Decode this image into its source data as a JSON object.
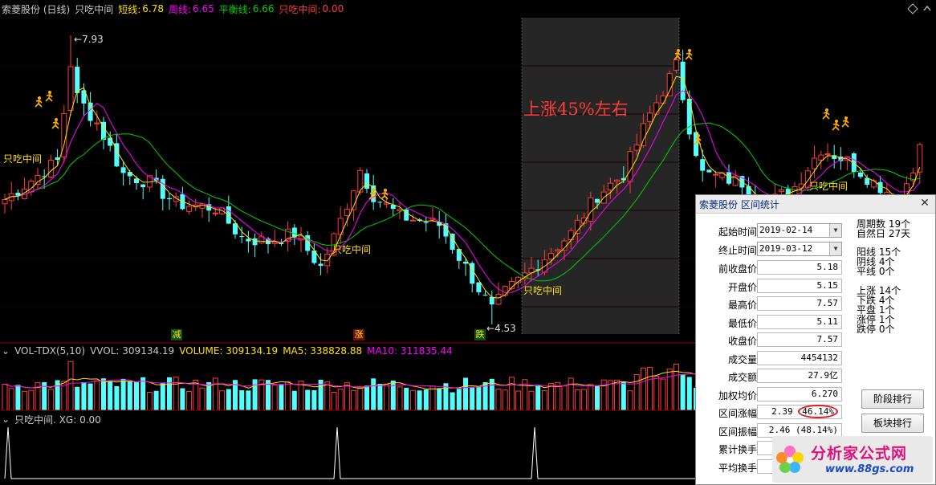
{
  "title": {
    "stock": "索菱股份 (日线)",
    "indicator": "只吃中间",
    "short_label": "短线:",
    "short_val": "6.78",
    "week_label": "周线:",
    "week_val": "6.65",
    "balance_label": "平衡线:",
    "balance_val": "6.66",
    "mid_label": "只吃中间:",
    "mid_val": "0.00"
  },
  "main": {
    "high_label": "7.93",
    "low_label": "4.53",
    "annotation": "上涨45%左右",
    "mid_labels": [
      "只吃中间",
      "只吃中间",
      "只吃中间",
      "只吃中间"
    ],
    "bottom_marks": [
      "减",
      "涨",
      "跌"
    ]
  },
  "vol": {
    "name": "VOL-TDX(5,10)",
    "vvol": "VVOL: 309134.19",
    "volume": "VOLUME: 309134.19",
    "ma5": "MA5: 338828.88",
    "ma10": "MA10: 311835.44"
  },
  "xg": {
    "label": "只吃中间. XG: 0.00"
  },
  "dialog": {
    "title": "索菱股份 区间统计",
    "start_label": "起始时间",
    "start_val": "2019-02-14",
    "end_label": "终止时间",
    "end_val": "2019-03-12",
    "rows": [
      {
        "label": "前收盘价",
        "value": "5.18"
      },
      {
        "label": "开盘价",
        "value": "5.15"
      },
      {
        "label": "最高价",
        "value": "7.57"
      },
      {
        "label": "最低价",
        "value": "5.11"
      },
      {
        "label": "收盘价",
        "value": "7.57"
      },
      {
        "label": "成交量",
        "value": "4454132"
      },
      {
        "label": "成交额",
        "value": "27.9亿"
      },
      {
        "label": "加权均价",
        "value": "6.270"
      },
      {
        "label": "区间涨幅",
        "value": "2.39",
        "pct": "46.14%"
      },
      {
        "label": "区间振幅",
        "value": "2.46 (48.14%)"
      },
      {
        "label": "累计换手",
        "value": ""
      },
      {
        "label": "平均换手",
        "value": ""
      }
    ],
    "right_stats": [
      {
        "label": "周期数",
        "value": "19个"
      },
      {
        "label": "自然日",
        "value": "27天"
      },
      {
        "label": "阳线",
        "value": "15个"
      },
      {
        "label": "阴线",
        "value": "4个"
      },
      {
        "label": "平线",
        "value": "0个"
      },
      {
        "label": "上涨",
        "value": "14个"
      },
      {
        "label": "下跌",
        "value": "4个"
      },
      {
        "label": "平盘",
        "value": "1个"
      },
      {
        "label": "涨停",
        "value": "1个"
      },
      {
        "label": "跌停",
        "value": "0个"
      }
    ],
    "btn_stage": "阶段排行",
    "btn_sector": "板块排行"
  },
  "watermark": {
    "name": "分析家公式网",
    "url": "www.88gs.com"
  },
  "colors": {
    "up": "#ff3b3b",
    "down": "#55ffff",
    "short": "#ffe000",
    "week": "#ff00ff",
    "balance": "#00d000",
    "annotation": "#ff3b3b",
    "highlight": "#262626",
    "ring": "#e02020"
  }
}
